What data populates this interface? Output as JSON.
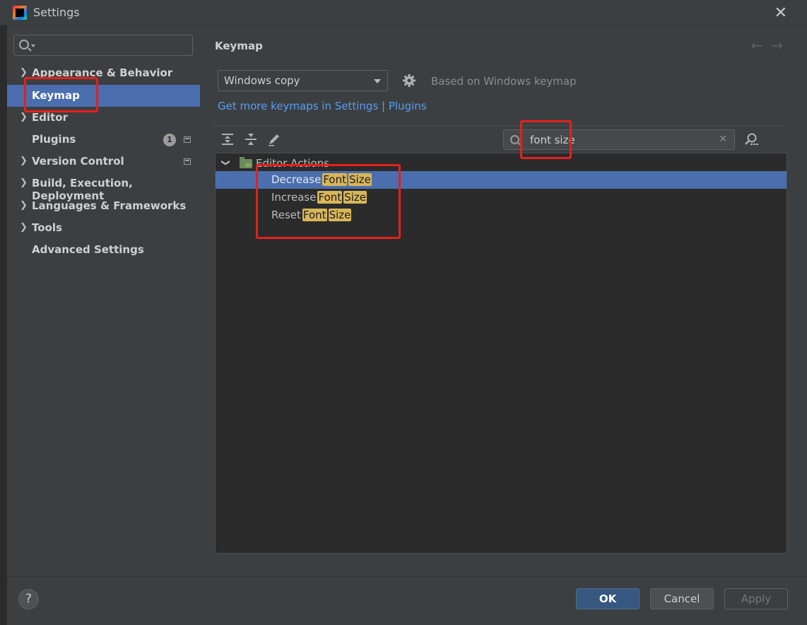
{
  "window": {
    "title": "Settings"
  },
  "sidebar": {
    "items": [
      {
        "label": "Appearance & Behavior",
        "expandable": true
      },
      {
        "label": "Keymap",
        "selected": true
      },
      {
        "label": "Editor",
        "expandable": true
      },
      {
        "label": "Plugins",
        "badge": "1"
      },
      {
        "label": "Version Control",
        "expandable": true
      },
      {
        "label": "Build, Execution, Deployment",
        "expandable": true
      },
      {
        "label": "Languages & Frameworks",
        "expandable": true
      },
      {
        "label": "Tools",
        "expandable": true
      },
      {
        "label": "Advanced Settings"
      }
    ]
  },
  "main": {
    "title": "Keymap",
    "keymap_select": {
      "value": "Windows copy"
    },
    "based_on": "Based on Windows keymap",
    "get_more_link": "Get more keymaps in Settings | Plugins",
    "filter": {
      "value": "font size"
    },
    "tree": {
      "group": "Editor Actions",
      "rows": [
        {
          "prefix": "Decrease",
          "selected": true
        },
        {
          "prefix": "Increase"
        },
        {
          "prefix": "Reset"
        }
      ],
      "match_word_1": "Font",
      "match_word_2": "Size"
    }
  },
  "footer": {
    "help_label": "?",
    "ok_label": "OK",
    "cancel_label": "Cancel",
    "apply_label": "Apply"
  },
  "colors": {
    "selection": "#4b6eaf",
    "highlight": "#d9b65a",
    "annotation": "#e5201d",
    "link": "#589df6"
  }
}
